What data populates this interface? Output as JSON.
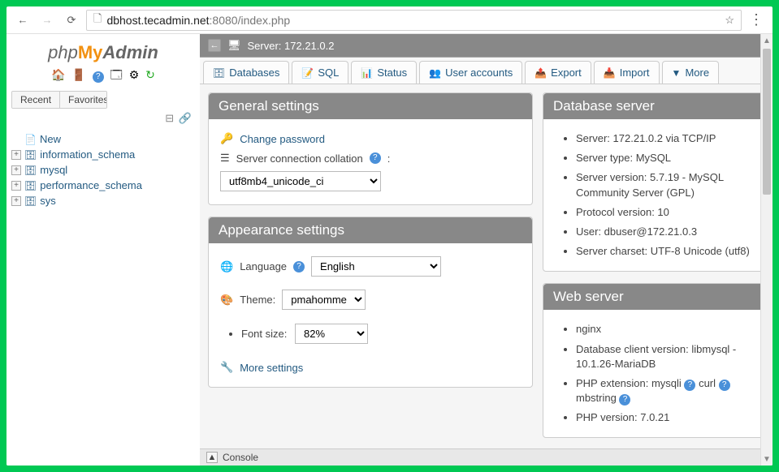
{
  "browser": {
    "url_host": "dbhost.tecadmin.net",
    "url_port_path": ":8080/index.php"
  },
  "logo": {
    "php": "php",
    "my": "My",
    "admin": "Admin"
  },
  "sidebar": {
    "tabs": {
      "recent": "Recent",
      "favorites": "Favorites"
    },
    "tree": [
      {
        "label": "New",
        "icon": "🆕",
        "leaf": true
      },
      {
        "label": "information_schema",
        "icon": "🗄",
        "leaf": false
      },
      {
        "label": "mysql",
        "icon": "🗄",
        "leaf": false
      },
      {
        "label": "performance_schema",
        "icon": "🗄",
        "leaf": false
      },
      {
        "label": "sys",
        "icon": "🗄",
        "leaf": false
      }
    ]
  },
  "server_bar": {
    "label": "Server: 172.21.0.2"
  },
  "topmenu": [
    {
      "icon": "🗄",
      "label": "Databases"
    },
    {
      "icon": "📝",
      "label": "SQL"
    },
    {
      "icon": "📊",
      "label": "Status"
    },
    {
      "icon": "👥",
      "label": "User accounts"
    },
    {
      "icon": "📤",
      "label": "Export"
    },
    {
      "icon": "📥",
      "label": "Import"
    },
    {
      "icon": "▼",
      "label": "More"
    }
  ],
  "general": {
    "title": "General settings",
    "change_password": "Change password",
    "collation_label": "Server connection collation",
    "collation_value": "utf8mb4_unicode_ci"
  },
  "appearance": {
    "title": "Appearance settings",
    "lang_label": "Language",
    "lang_value": "English",
    "theme_label": "Theme:",
    "theme_value": "pmahomme",
    "font_label": "Font size:",
    "font_value": "82%",
    "more": "More settings"
  },
  "dbserver": {
    "title": "Database server",
    "items": [
      "Server: 172.21.0.2 via TCP/IP",
      "Server type: MySQL",
      "Server version: 5.7.19 - MySQL Community Server (GPL)",
      "Protocol version: 10",
      "User: dbuser@172.21.0.3",
      "Server charset: UTF-8 Unicode (utf8)"
    ]
  },
  "webserver": {
    "title": "Web server",
    "items_text": {
      "0": "nginx",
      "1a": "Database client version: libmysql - 10.1.26-MariaDB",
      "2a": "PHP extension: mysqli ",
      "2b": " curl ",
      "2c": " mbstring ",
      "3": "PHP version: 7.0.21"
    }
  },
  "pma_panel": {
    "title": "phpMyAdmin"
  },
  "console": {
    "label": "Console"
  }
}
